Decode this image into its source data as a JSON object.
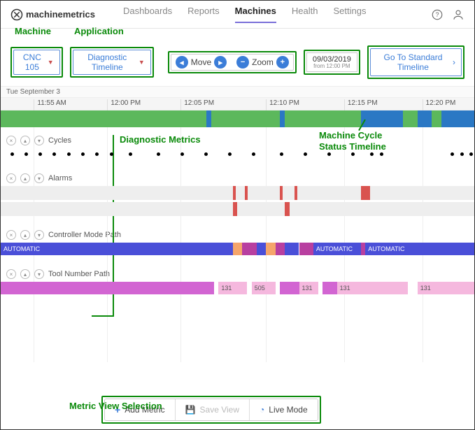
{
  "brand": {
    "name": "machinemetrics"
  },
  "nav": {
    "tabs": [
      "Dashboards",
      "Reports",
      "Machines",
      "Health",
      "Settings"
    ],
    "active": 2
  },
  "annotations": {
    "machine": "Machine",
    "application": "Application",
    "diag_metrics": "Diagnostic Metrics",
    "cycle_status": "Machine Cycle\nStatus Timeline",
    "metric_view": "Metric View Selection"
  },
  "machine_dd": {
    "label": "CNC 105"
  },
  "app_dd": {
    "label": "Diagnostic Timeline"
  },
  "controls": {
    "move": "Move",
    "zoom": "Zoom"
  },
  "date": {
    "value": "09/03/2019",
    "sub": "from 12:00 PM"
  },
  "std_btn": "Go To Standard Timeline",
  "date_label": "Tue September 3",
  "time_axis": [
    {
      "label": "11:55 AM",
      "pct": 7
    },
    {
      "label": "12:00 PM",
      "pct": 22.5
    },
    {
      "label": "12:05 PM",
      "pct": 38
    },
    {
      "label": "12:10 PM",
      "pct": 56
    },
    {
      "label": "12:15 PM",
      "pct": 72.5
    },
    {
      "label": "12:20 PM",
      "pct": 89
    }
  ],
  "status_segments": [
    {
      "start": 0,
      "end": 43.5,
      "color": "#5cb85c"
    },
    {
      "start": 43.5,
      "end": 44.5,
      "color": "#2b78c4"
    },
    {
      "start": 44.5,
      "end": 59,
      "color": "#5cb85c"
    },
    {
      "start": 59,
      "end": 60,
      "color": "#2b78c4"
    },
    {
      "start": 60,
      "end": 76,
      "color": "#5cb85c"
    },
    {
      "start": 76,
      "end": 85,
      "color": "#2b78c4"
    },
    {
      "start": 85,
      "end": 88,
      "color": "#5cb85c"
    },
    {
      "start": 88,
      "end": 91,
      "color": "#2b78c4"
    },
    {
      "start": 91,
      "end": 93,
      "color": "#5cb85c"
    },
    {
      "start": 93,
      "end": 100,
      "color": "#2b78c4"
    }
  ],
  "lanes": {
    "cycles": {
      "label": "Cycles",
      "dots": [
        2,
        5,
        8,
        11,
        14,
        17,
        20,
        23,
        27,
        33,
        38,
        43,
        48,
        53,
        59,
        64,
        69,
        74,
        78,
        80,
        95,
        97,
        99
      ]
    },
    "alarms": {
      "label": "Alarms",
      "marks_top": [
        {
          "start": 49,
          "end": 49.5
        },
        {
          "start": 51.5,
          "end": 52
        },
        {
          "start": 59,
          "end": 59.5
        },
        {
          "start": 62,
          "end": 62.5
        },
        {
          "start": 76,
          "end": 78
        }
      ],
      "marks_bot": [
        {
          "start": 49,
          "end": 50
        },
        {
          "start": 60,
          "end": 61
        }
      ]
    },
    "controller": {
      "label": "Controller Mode Path",
      "segs": [
        {
          "start": 0,
          "end": 49,
          "color": "#4a4fd8",
          "text": "AUTOMATIC"
        },
        {
          "start": 49,
          "end": 51,
          "color": "#f5a56b",
          "text": ""
        },
        {
          "start": 51,
          "end": 54,
          "color": "#b83fa0",
          "text": ""
        },
        {
          "start": 54,
          "end": 56,
          "color": "#4a4fd8",
          "text": ""
        },
        {
          "start": 56,
          "end": 58,
          "color": "#f5a56b",
          "text": ""
        },
        {
          "start": 58,
          "end": 60,
          "color": "#b83fa0",
          "text": ""
        },
        {
          "start": 60,
          "end": 63,
          "color": "#4a4fd8",
          "text": ""
        },
        {
          "start": 63,
          "end": 66,
          "color": "#b83fa0",
          "text": ""
        },
        {
          "start": 66,
          "end": 76,
          "color": "#4a4fd8",
          "text": "AUTOMATIC"
        },
        {
          "start": 76,
          "end": 77,
          "color": "#b83fa0",
          "text": ""
        },
        {
          "start": 77,
          "end": 100,
          "color": "#4a4fd8",
          "text": "AUTOMATIC"
        }
      ]
    },
    "tool": {
      "label": "Tool Number Path",
      "segs": [
        {
          "start": 0,
          "end": 45,
          "color": "#d265d2",
          "text": ""
        },
        {
          "start": 46,
          "end": 52,
          "color": "#f5b8de",
          "text": "131"
        },
        {
          "start": 53,
          "end": 58,
          "color": "#f5b8de",
          "text": "505"
        },
        {
          "start": 59,
          "end": 63,
          "color": "#d265d2",
          "text": ""
        },
        {
          "start": 63,
          "end": 67,
          "color": "#f5b8de",
          "text": "131"
        },
        {
          "start": 68,
          "end": 71,
          "color": "#d265d2",
          "text": ""
        },
        {
          "start": 71,
          "end": 86,
          "color": "#f5b8de",
          "text": "131"
        },
        {
          "start": 88,
          "end": 100,
          "color": "#f5b8de",
          "text": "131"
        }
      ]
    }
  },
  "bottom_buttons": {
    "add": "Add Metric",
    "save": "Save View",
    "live": "Live Mode"
  }
}
